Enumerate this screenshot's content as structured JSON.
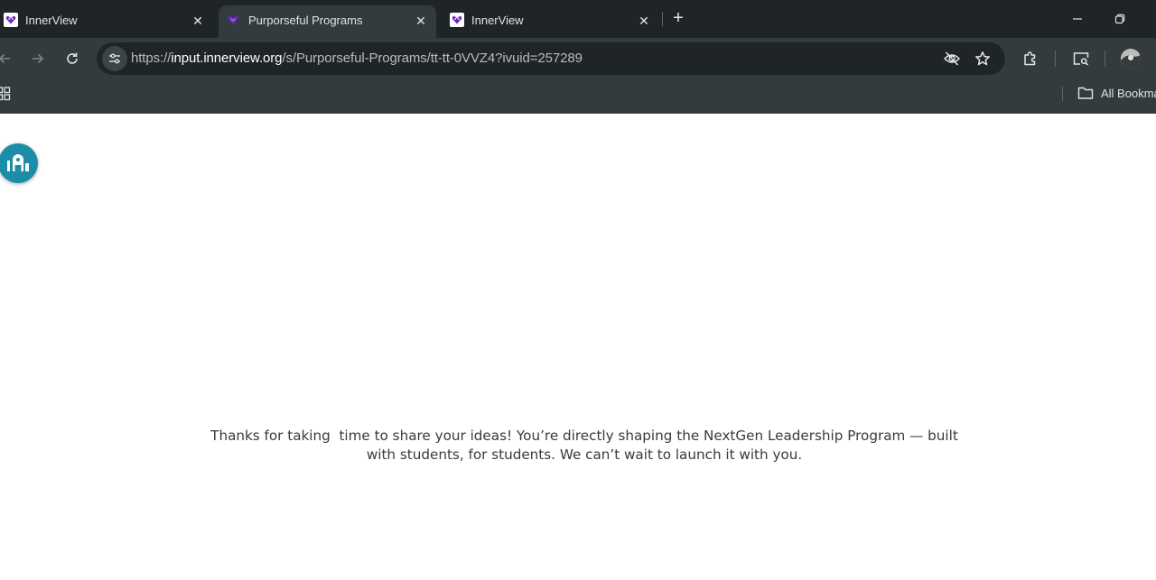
{
  "browser": {
    "tabs": [
      {
        "title": "InnerView",
        "close": "✕",
        "active": false,
        "favicon": "innerview-logo-icon"
      },
      {
        "title": "Purporseful Programs",
        "close": "✕",
        "active": true,
        "favicon": "purple-heart-logo-icon"
      },
      {
        "title": "InnerView",
        "close": "✕",
        "active": false,
        "favicon": "innerview-logo-icon"
      }
    ],
    "new_tab": "+",
    "address": {
      "scheme": "https://",
      "host": "input.innerview.org",
      "path": "/s/Purporseful-Programs/tt-tt-0VVZ4?ivuid=257289"
    },
    "bookmarks_bar": {
      "all_bookmarks_label": "All Bookma"
    },
    "colors": {
      "tabstrip": "#1f2526",
      "toolbar": "#333b3c",
      "omnibox": "#1f2526"
    }
  },
  "page": {
    "thank_you_message": "Thanks for taking  time to share your ideas! You’re directly shaping the NextGen Leadership Program — built with students, for students. We can’t wait to launch it with you.",
    "accessibility_button": {
      "icon": "accessibility-icon",
      "color": "#1b8da8"
    }
  }
}
